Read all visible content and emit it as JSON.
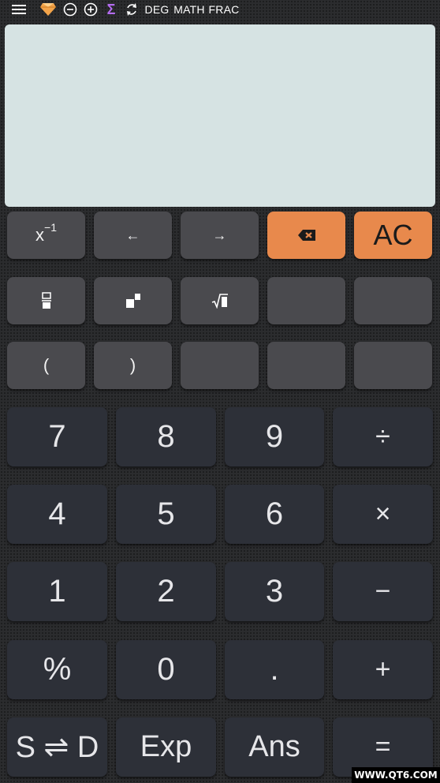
{
  "topbar": {
    "mode_angle": "DEG",
    "mode_input": "MATH",
    "mode_output": "FRAC",
    "icons": [
      "menu-icon",
      "diamond-icon",
      "zoom-out-icon",
      "zoom-in-icon",
      "sigma-icon",
      "refresh-icon"
    ],
    "sigma_glyph": "Σ",
    "diamond_color": "#f3a44a",
    "sigma_color": "#b46cf0"
  },
  "display": {
    "background": "#d6e3e3",
    "content": ""
  },
  "rows": {
    "row1": {
      "inverse_base": "x",
      "inverse_exp": "−1",
      "cursor_left": "←",
      "cursor_right": "→",
      "clear": "AC"
    },
    "row3": {
      "open_paren": "(",
      "close_paren": ")"
    },
    "numpad": {
      "n7": "7",
      "n8": "8",
      "n9": "9",
      "divide": "÷",
      "n4": "4",
      "n5": "5",
      "n6": "6",
      "multiply": "×",
      "n1": "1",
      "n2": "2",
      "n3": "3",
      "minus": "−",
      "percent": "%",
      "n0": "0",
      "dot": ".",
      "plus": "+",
      "sd": "S ⇌ D",
      "exp": "Exp",
      "ans": "Ans",
      "equals": "="
    }
  },
  "colors": {
    "accent": "#e8894c",
    "fn_key": "#4a4a4e",
    "num_key": "#2d3038"
  },
  "watermark": "WWW.QT6.COM"
}
